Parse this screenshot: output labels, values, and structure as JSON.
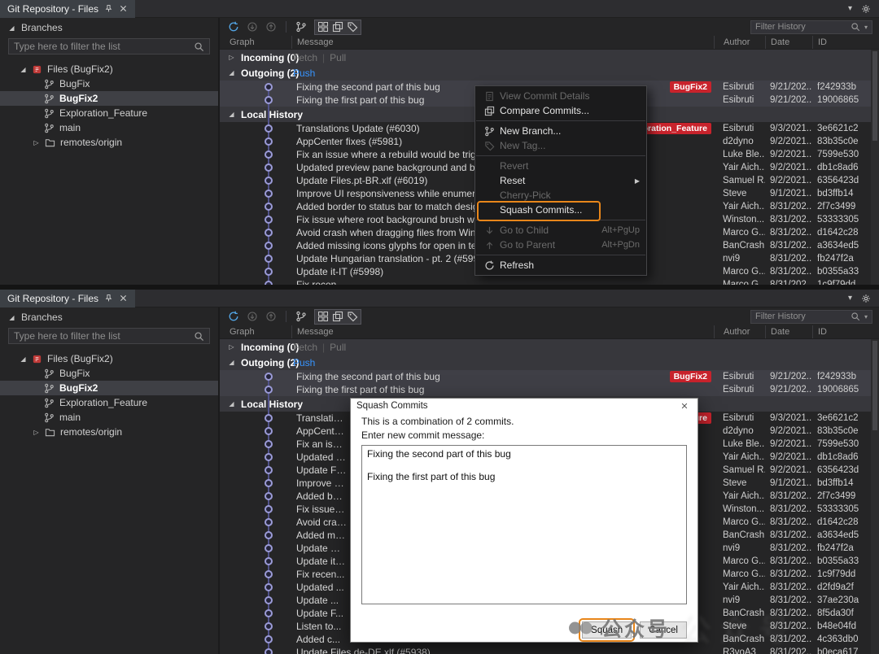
{
  "window": {
    "tab_title": "Git Repository - Files"
  },
  "icons": {
    "expander_expanded": "◢",
    "expander_collapsed": "▷",
    "caret_down": "▾",
    "submenu_arrow": "▶",
    "link_separator": "|"
  },
  "colors": {
    "accent_orange": "#e8861a",
    "badge_red": "#c8232c",
    "link_blue": "#3794ff",
    "graph_line": "#53548c",
    "selection_gray": "#3f3f46"
  },
  "sidebar": {
    "header": "Branches",
    "filter_placeholder": "Type here to filter the list",
    "repo_label": "Files (BugFix2)",
    "items": [
      {
        "label": "BugFix"
      },
      {
        "label": "BugFix2"
      },
      {
        "label": "Exploration_Feature"
      },
      {
        "label": "main"
      }
    ],
    "remotes_label": "remotes/origin"
  },
  "history": {
    "filter_placeholder": "Filter History",
    "columns": [
      "Graph",
      "Message",
      "Author",
      "Date",
      "ID"
    ],
    "incoming_label": "Incoming (0)",
    "fetch_link": "Fetch",
    "pull_link": "Pull",
    "outgoing_label": "Outgoing (2)",
    "push_link": "Push",
    "local_history_label": "Local History",
    "outgoing_commits": [
      {
        "message": "Fixing the second part of this bug",
        "badge": "BugFix2",
        "author": "Esibruti",
        "date": "9/21/202...",
        "id": "f242933b"
      },
      {
        "message": "Fixing the first part of this bug",
        "author": "Esibruti",
        "date": "9/21/202...",
        "id": "19006865"
      }
    ],
    "local_commits": [
      {
        "message": "Translations Update (#6030)",
        "badge": "loration_Feature",
        "author": "Esibruti",
        "date": "9/3/2021...",
        "id": "3e6621c2"
      },
      {
        "message": "AppCenter fixes (#5981)",
        "author": "d2dyno",
        "date": "9/2/2021...",
        "id": "83b35c0e"
      },
      {
        "message": "Fix an issue where a rebuild would be triggered o...",
        "author": "Luke Ble...",
        "date": "9/2/2021...",
        "id": "7599e530"
      },
      {
        "message": "Updated preview pane background and border (#...",
        "author": "Yair Aich...",
        "date": "9/2/2021...",
        "id": "db1c8ad6"
      },
      {
        "message": "Update Files.pt-BR.xlf (#6019)",
        "author": "Samuel R...",
        "date": "9/2/2021...",
        "id": "6356423d"
      },
      {
        "message": "Improve UI responsiveness while enumerating (#...",
        "author": "Steve",
        "date": "9/1/2021...",
        "id": "bd3ffb14"
      },
      {
        "message": "Added border to status bar to match design spec...",
        "author": "Yair Aich...",
        "date": "8/31/202...",
        "id": "2f7c3499"
      },
      {
        "message": "Fix issue where root background brush wouldn't ...",
        "author": "Winston...",
        "date": "8/31/202...",
        "id": "53333305"
      },
      {
        "message": "Avoid crash when dragging files from WinRAR (#...",
        "author": "Marco G...",
        "date": "8/31/202...",
        "id": "d1642c28"
      },
      {
        "message": "Added missing icons glyphs for open in terminal a...",
        "author": "BanCrash",
        "date": "8/31/202...",
        "id": "a3634ed5"
      },
      {
        "message": "Update Hungarian translation - pt. 2 (#5996)",
        "author": "nvi9",
        "date": "8/31/202...",
        "id": "fb247f2a"
      },
      {
        "message": "Update it-IT (#5998)",
        "author": "Marco G...",
        "date": "8/31/202...",
        "id": "b0355a33"
      },
      {
        "message": "Fix recen...",
        "author": "Marco G...",
        "date": "8/31/202...",
        "id": "1c9f79dd"
      },
      {
        "message": "Updated ...",
        "author": "Yair Aich...",
        "date": "8/31/202...",
        "id": "d2fd9a2f"
      },
      {
        "message": "Update ...",
        "author": "nvi9",
        "date": "8/31/202...",
        "id": "37ae230a"
      },
      {
        "message": "Update F...",
        "author": "BanCrash",
        "date": "8/31/202...",
        "id": "8f5da30f"
      },
      {
        "message": "Listen to...",
        "author": "Steve",
        "date": "8/31/202...",
        "id": "b48e04fd"
      },
      {
        "message": "Added c...",
        "author": "BanCrash",
        "date": "8/31/202...",
        "id": "4c363db0"
      },
      {
        "message": "Update Files.de-DE.xlf (#5938)",
        "author": "R3voA3",
        "date": "8/31/202...",
        "id": "b0eca617"
      }
    ]
  },
  "context_menu": {
    "items": [
      {
        "label": "View Commit Details"
      },
      {
        "label": "Compare Commits..."
      },
      {
        "label": "New Branch..."
      },
      {
        "label": "New Tag..."
      },
      {
        "label": "Revert"
      },
      {
        "label": "Reset"
      },
      {
        "label": "Cherry-Pick"
      },
      {
        "label": "Squash Commits..."
      },
      {
        "label": "Go to Child",
        "shortcut": "Alt+PgUp"
      },
      {
        "label": "Go to Parent",
        "shortcut": "Alt+PgDn"
      },
      {
        "label": "Refresh"
      }
    ]
  },
  "dialog": {
    "title": "Squash Commits",
    "description": "This is a combination of 2 commits.",
    "message_label": "Enter new commit message:",
    "message_value": "Fixing the second part of this bug\n\nFixing the first part of this bug",
    "squash_button": "Squash",
    "cancel_button": "Cancel"
  },
  "watermark": {
    "text": "公众号"
  }
}
